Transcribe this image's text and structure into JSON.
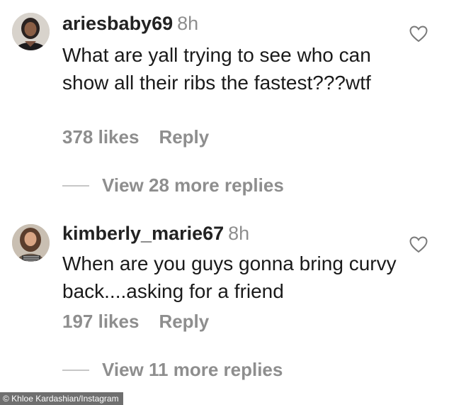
{
  "comments": [
    {
      "username": "ariesbaby69",
      "time": "8h",
      "text": "What are yall trying to see who can show all their ribs the fastest???wtf",
      "likes": "378 likes",
      "reply": "Reply",
      "view_replies": "View 28 more replies",
      "avatar_icon": "avatar-photo"
    },
    {
      "username": "kimberly_marie67",
      "time": "8h",
      "text": "When are you guys gonna bring curvy back....asking for a friend",
      "likes": "197 likes",
      "reply": "Reply",
      "view_replies": "View 11 more replies",
      "avatar_icon": "avatar-photo"
    }
  ],
  "credit": "© Khloe Kardashian/Instagram",
  "colors": {
    "text": "#1a1a1a",
    "muted": "#8e8e8e",
    "divider": "#c7c7c7",
    "credit_bg": "#6f6f6f"
  },
  "icons": {
    "like": "heart-outline-icon"
  }
}
